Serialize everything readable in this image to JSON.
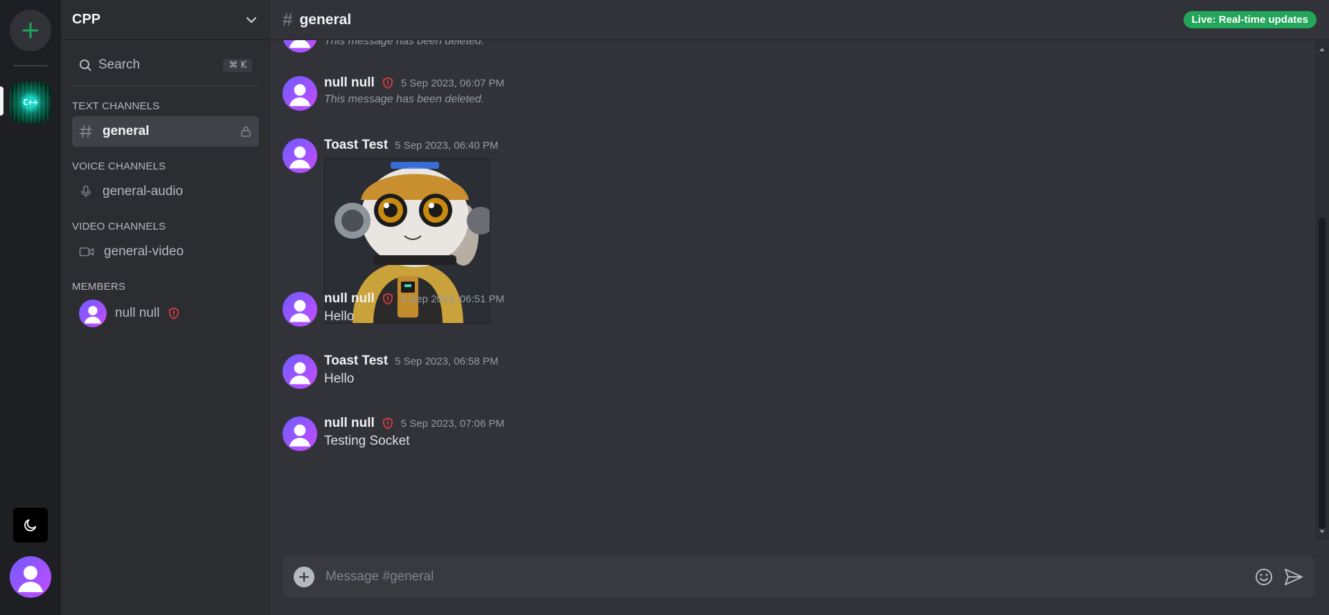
{
  "server": {
    "name": "CPP",
    "icon_text": "C++"
  },
  "sidebar": {
    "search_label": "Search",
    "search_shortcut": "⌘ K",
    "sections": {
      "text": "TEXT CHANNELS",
      "voice": "VOICE CHANNELS",
      "video": "VIDEO CHANNELS",
      "members": "MEMBERS"
    },
    "text_channel": "general",
    "voice_channel": "general-audio",
    "video_channel": "general-video",
    "member_name": "null null"
  },
  "header": {
    "channel": "general",
    "status_badge": "Live: Real-time updates"
  },
  "messages": [
    {
      "author": "",
      "time": "",
      "text": "This message has been deleted.",
      "deleted": true
    },
    {
      "author": "null null",
      "time": "5 Sep 2023, 06:07 PM",
      "text": "This message has been deleted.",
      "deleted": true,
      "admin": true
    },
    {
      "author": "Toast Test",
      "time": "5 Sep 2023, 06:40 PM",
      "text": "",
      "image": true
    },
    {
      "author": "null null",
      "time": "5 Sep 2023, 06:51 PM",
      "text": "Hello",
      "admin": true
    },
    {
      "author": "Toast Test",
      "time": "5 Sep 2023, 06:58 PM",
      "text": "Hello"
    },
    {
      "author": "null null",
      "time": "5 Sep 2023, 07:06 PM",
      "text": "Testing Socket",
      "admin": true
    }
  ],
  "composer": {
    "placeholder": "Message #general"
  },
  "colors": {
    "accent": "#23a55a",
    "admin_shield": "#f23f43",
    "avatar_gradient": [
      "#6d5cff",
      "#c84bff"
    ]
  }
}
